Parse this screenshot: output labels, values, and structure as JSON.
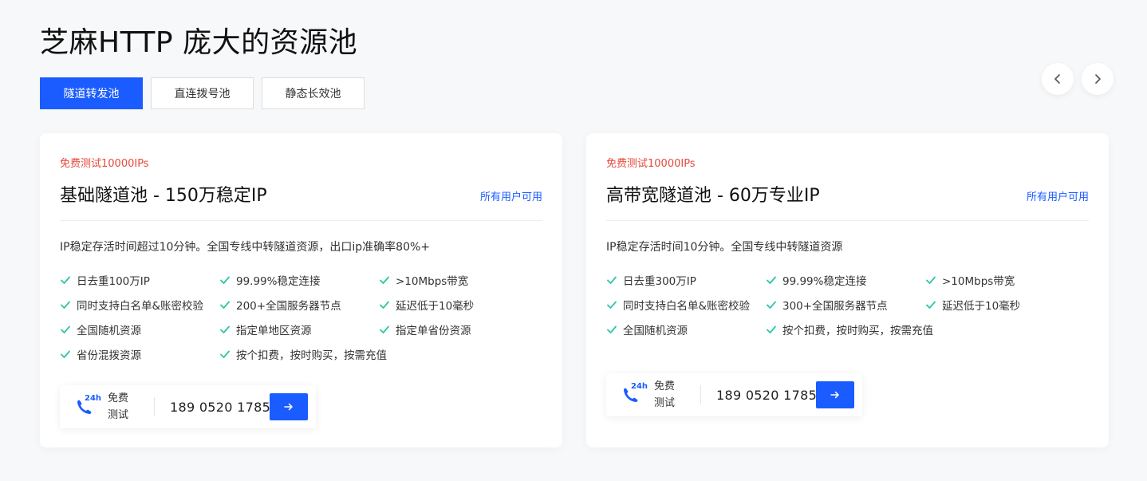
{
  "page_title": "芝麻HTTP 庞大的资源池",
  "tabs": [
    {
      "label": "隧道转发池",
      "active": true
    },
    {
      "label": "直连拨号池",
      "active": false
    },
    {
      "label": "静态长效池",
      "active": false
    }
  ],
  "nav": {
    "prev_icon": "chevron-left-icon",
    "next_icon": "chevron-right-icon"
  },
  "colors": {
    "accent": "#1a5cff",
    "promo": "#e5493a",
    "check": "#2cc6a5"
  },
  "cards": [
    {
      "promo": "免费测试10000IPs",
      "title": "基础隧道池 - 150万稳定IP",
      "availability": "所有用户可用",
      "description": "IP稳定存活时间超过10分钟。全国专线中转隧道资源，出口ip准确率80%+",
      "features": [
        "日去重100万IP",
        "99.99%稳定连接",
        ">10Mbps带宽",
        "同时支持白名单&账密校验",
        "200+全国服务器节点",
        "延迟低于10毫秒",
        "全国随机资源",
        "指定单地区资源",
        "指定单省份资源",
        "省份混拨资源",
        "按个扣费，按时购买，按需充值"
      ],
      "contact": {
        "badge": "24h",
        "free_line1": "免费",
        "free_line2": "测试",
        "phone": "189 0520 1785"
      }
    },
    {
      "promo": "免费测试10000IPs",
      "title": "高带宽隧道池 - 60万专业IP",
      "availability": "所有用户可用",
      "description": "IP稳定存活时间10分钟。全国专线中转隧道资源",
      "features": [
        "日去重300万IP",
        "99.99%稳定连接",
        ">10Mbps带宽",
        "同时支持白名单&账密校验",
        "300+全国服务器节点",
        "延迟低于10毫秒",
        "全国随机资源",
        "按个扣费，按时购买，按需充值"
      ],
      "contact": {
        "badge": "24h",
        "free_line1": "免费",
        "free_line2": "测试",
        "phone": "189 0520 1785"
      }
    }
  ]
}
